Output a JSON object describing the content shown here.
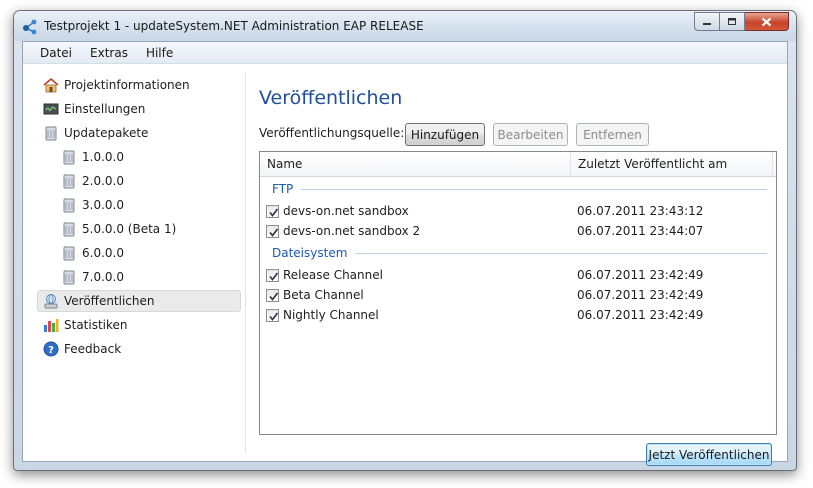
{
  "window": {
    "title": "Testprojekt 1 - updateSystem.NET Administration EAP RELEASE"
  },
  "menu": [
    "Datei",
    "Extras",
    "Hilfe"
  ],
  "sidebar": {
    "items": [
      {
        "label": "Projektinformationen",
        "icon": "house-icon"
      },
      {
        "label": "Einstellungen",
        "icon": "settings-panel-icon"
      },
      {
        "label": "Updatepakete",
        "icon": "package-icon"
      },
      {
        "label": "1.0.0.0",
        "icon": "package-icon"
      },
      {
        "label": "2.0.0.0",
        "icon": "package-icon"
      },
      {
        "label": "3.0.0.0",
        "icon": "package-icon"
      },
      {
        "label": "5.0.0.0 (Beta 1)",
        "icon": "package-icon"
      },
      {
        "label": "6.0.0.0",
        "icon": "package-icon"
      },
      {
        "label": "7.0.0.0",
        "icon": "package-icon"
      },
      {
        "label": "Veröffentlichen",
        "icon": "publish-icon"
      },
      {
        "label": "Statistiken",
        "icon": "bar-chart-icon"
      },
      {
        "label": "Feedback",
        "icon": "help-icon"
      }
    ]
  },
  "main": {
    "title": "Veröffentlichen",
    "source_label": "Veröffentlichungsquelle:",
    "buttons": {
      "add": "Hinzufügen",
      "edit": "Bearbeiten",
      "remove": "Entfernen",
      "publish_now": "Jetzt Veröffentlichen"
    },
    "columns": [
      "Name",
      "Zuletzt Veröffentlicht am"
    ],
    "groups": [
      {
        "label": "FTP",
        "rows": [
          {
            "name": "devs-on.net sandbox",
            "date": "06.07.2011 23:43:12",
            "checked": true
          },
          {
            "name": "devs-on.net sandbox 2",
            "date": "06.07.2011 23:44:07",
            "checked": true
          }
        ]
      },
      {
        "label": "Dateisystem",
        "rows": [
          {
            "name": "Release Channel",
            "date": "06.07.2011 23:42:49",
            "checked": true
          },
          {
            "name": "Beta Channel",
            "date": "06.07.2011 23:42:49",
            "checked": true
          },
          {
            "name": "Nightly Channel",
            "date": "06.07.2011 23:42:49",
            "checked": true
          }
        ]
      }
    ]
  }
}
